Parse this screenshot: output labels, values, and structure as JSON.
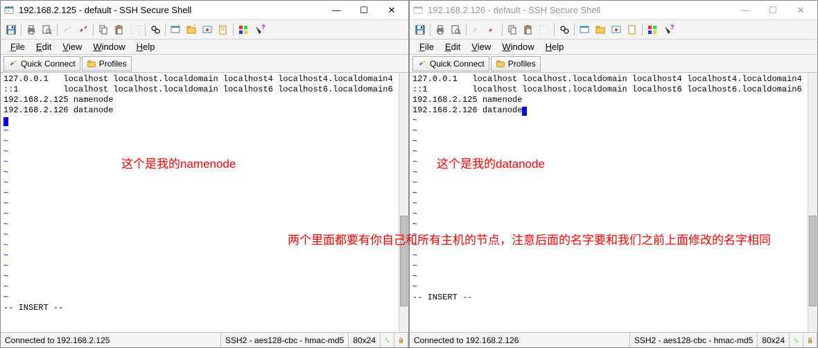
{
  "windows": [
    {
      "title": "192.168.2.125 - default - SSH Secure Shell",
      "active": true,
      "terminal_lines": [
        "127.0.0.1   localhost localhost.localdomain localhost4 localhost4.localdomain4",
        "::1         localhost localhost.localdomain localhost6 localhost6.localdomain6",
        "192.168.2.125 namenode",
        "192.168.2.126 datanode"
      ],
      "cursor_after_line": 3,
      "cursor_col": 0,
      "insert_mode": "-- INSERT --",
      "status_connected": "Connected to 192.168.2.125",
      "status_cipher": "SSH2 - aes128-cbc - hmac-md5",
      "status_size": "80x24"
    },
    {
      "title": "192.168.2.126 - default - SSH Secure Shell",
      "active": false,
      "terminal_lines": [
        "127.0.0.1   localhost localhost.localdomain localhost4 localhost4.localdomain4",
        "::1         localhost localhost.localdomain localhost6 localhost6.localdomain6",
        "192.168.2.125 namenode",
        "192.168.2.126 datanode"
      ],
      "cursor_after_line": 3,
      "cursor_col": 22,
      "insert_mode": "-- INSERT --",
      "status_connected": "Connected to 192.168.2.126",
      "status_cipher": "SSH2 - aes128-cbc - hmac-md5",
      "status_size": "80x24"
    }
  ],
  "menus": {
    "file": "File",
    "edit": "Edit",
    "view": "View",
    "window": "Window",
    "help": "Help"
  },
  "connect_bar": {
    "quick_connect": "Quick Connect",
    "profiles": "Profiles"
  },
  "win_controls": {
    "min": "—",
    "max": "☐",
    "close": "✕"
  },
  "annotations": {
    "left_node": "这个是我的namenode",
    "right_node": "这个是我的datanode",
    "bottom_note": "两个里面都要有你自己和所有主机的节点，注意后面的名字要和我们之前上面修改的名字相同"
  },
  "tilde_count": 17
}
